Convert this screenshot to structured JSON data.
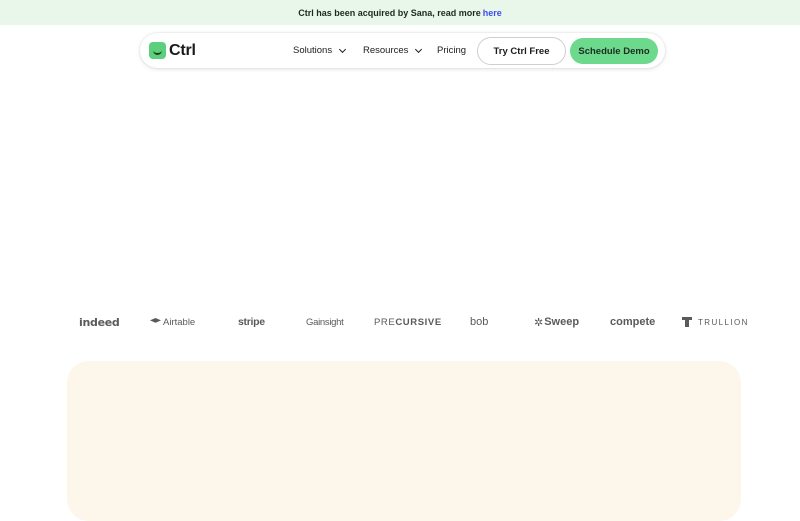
{
  "banner": {
    "text": "Ctrl has been acquired by Sana, read more",
    "link": "here"
  },
  "nav": {
    "logo_text": "Ctrl",
    "items": [
      {
        "label": "Solutions",
        "has_dropdown": true
      },
      {
        "label": "Resources",
        "has_dropdown": true
      },
      {
        "label": "Pricing",
        "has_dropdown": false
      }
    ],
    "try_button": "Try Ctrl Free",
    "demo_button": "Schedule Demo"
  },
  "logos": {
    "indeed": "indeed",
    "airtable": "Airtable",
    "stripe": "stripe",
    "gainsight": "Gainsight",
    "precursive_pre": "PRE",
    "precursive_main": "CURSIVE",
    "bob": "bob",
    "sweep_glyph": "✲",
    "sweep": "Sweep",
    "compete": "compete",
    "trullion": "TRULLION"
  },
  "colors": {
    "banner_bg": "#e8f7ea",
    "link": "#3b4cf0",
    "brand_green": "#6cd98d",
    "cream": "#fdf6ea"
  },
  "icons": [
    "ctrl-logo-icon",
    "chevron-down-icon",
    "airtable-icon",
    "sweep-icon",
    "trullion-icon"
  ]
}
